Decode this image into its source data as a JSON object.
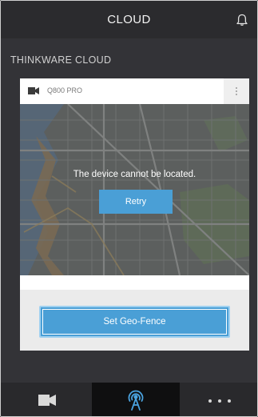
{
  "header": {
    "title": "CLOUD",
    "notification_icon": "bell-icon"
  },
  "section": {
    "title": "THINKWARE CLOUD"
  },
  "device_card": {
    "camera_icon": "camera-icon",
    "device_name": "Q800 PRO",
    "more_icon": "vertical-dots-icon",
    "map_message": "The device cannot be located.",
    "retry_label": "Retry"
  },
  "geo_fence": {
    "label": "Set Geo-Fence"
  },
  "tabs": [
    {
      "name": "video",
      "icon": "video-camera-icon",
      "selected": false
    },
    {
      "name": "cloud",
      "icon": "cloud-signal-icon",
      "selected": true
    },
    {
      "name": "more",
      "icon": "more-dots-icon",
      "selected": false
    }
  ],
  "colors": {
    "accent": "#4a9fd6",
    "background": "#2b2b2e",
    "content": "#333337",
    "selected_tab": "#0f0f10",
    "cloud_icon": "#4aa3e0"
  }
}
